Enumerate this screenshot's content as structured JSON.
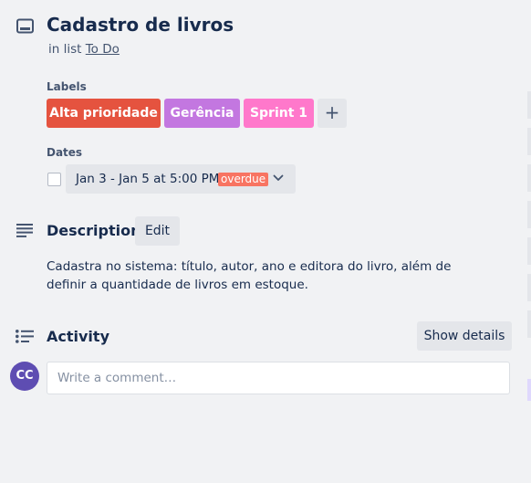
{
  "card": {
    "title": "Cadastro de livros",
    "in_list_prefix": "in list",
    "list_name": "To Do"
  },
  "labels_section": {
    "heading": "Labels",
    "labels": [
      {
        "name": "Alta prioridade",
        "color": "#e5533f"
      },
      {
        "name": "Gerência",
        "color": "#c377e0"
      },
      {
        "name": "Sprint 1",
        "color": "#ff78cb"
      }
    ],
    "add_label": "+"
  },
  "dates_section": {
    "heading": "Dates",
    "range": "Jan 3 - Jan 5 at 5:00 PM",
    "status": "overdue",
    "checked": false
  },
  "description_section": {
    "title": "Description",
    "edit_label": "Edit",
    "text": "Cadastra no sistema: título, autor, ano e editora do livro, além de definir a quantidade de livros em estoque."
  },
  "activity_section": {
    "title": "Activity",
    "show_details_label": "Show details",
    "avatar_initials": "CC",
    "comment_placeholder": "Write a comment…"
  },
  "icons": {
    "card": "card-icon",
    "description": "description-icon",
    "activity": "activity-icon",
    "dropdown": "chevron-down-icon"
  },
  "colors": {
    "background": "#f1f2f4",
    "overdue": "#f87462",
    "avatar": "#5e4db2"
  }
}
